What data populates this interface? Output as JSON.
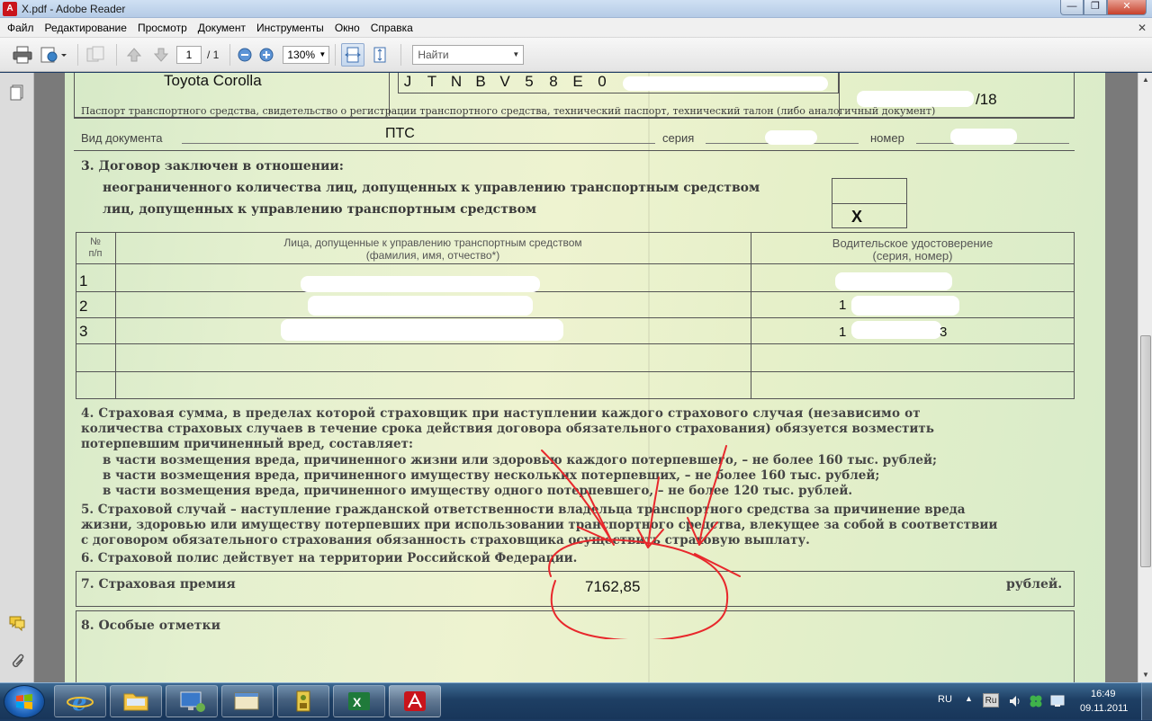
{
  "window": {
    "title": "X.pdf - Adobe Reader",
    "controls": {
      "minimize": "—",
      "maximize": "❐",
      "close": "✕"
    }
  },
  "menu": {
    "items": [
      "Файл",
      "Редактирование",
      "Просмотр",
      "Документ",
      "Инструменты",
      "Окно",
      "Справка"
    ],
    "close_doc": "✕"
  },
  "toolbar": {
    "page_current": "1",
    "page_total": "/ 1",
    "zoom": "130%",
    "search_placeholder": "Найти"
  },
  "document": {
    "car_model": "Toyota Corolla",
    "vin_visible": [
      "J",
      "T",
      "N",
      "B",
      "V",
      "5",
      "8",
      "E",
      "0"
    ],
    "number_suffix": "/18",
    "doc_types_line": "Паспорт транспортного средства, свидетельство о регистрации транспортного средства, технический паспорт, технический талон (либо аналогичный документ)",
    "doc_type_label": "Вид документа",
    "doc_type_value": "ПТС",
    "series_label": "серия",
    "number_label": "номер",
    "section3_title": "3. Договор заключен в отношении:",
    "section3_opt1": "неограниченного количества лиц, допущенных к управлению транспортным средством",
    "section3_opt2": "лиц, допущенных к управлению транспортным средством",
    "section3_mark": "X",
    "table_col_num": "№\nп/п",
    "table_col_persons": "Лица, допущенные к управлению транспортным средством",
    "table_col_persons_sub": "(фамилия, имя, отчество*)",
    "table_col_license": "Водительское удостоверение",
    "table_col_license_sub": "(серия, номер)",
    "table_rows": [
      "1",
      "2",
      "3",
      "",
      ""
    ],
    "license_fragments": [
      "1",
      "1",
      "3"
    ],
    "section4_l1": "4. Страховая сумма, в пределах которой страховщик при наступлении каждого страхового случая (независимо от",
    "section4_l2": "количества страховых случаев в течение срока действия договора обязательного страхования) обязуется возместить",
    "section4_l3": "потерпевшим причиненный вред, составляет:",
    "section4_b1": "в части возмещения вреда, причиненного жизни или здоровью каждого потерпевшего, – не более 160 тыс. рублей;",
    "section4_b2": "в части возмещения вреда, причиненного имуществу нескольких потерпевших, – не более 160 тыс. рублей;",
    "section4_b3": "в части возмещения вреда, причиненного имуществу одного потерпевшего, – не более 120 тыс. рублей.",
    "section5_l1": "5. Страховой случай – наступление гражданской ответственности владельца транспортного средства за причинение вреда",
    "section5_l2": "жизни, здоровью или имуществу потерпевших при использовании транспортного средства, влекущее за собой в соответствии",
    "section5_l3": "с договором обязательного страхования обязанность страховщика осуществить страховую выплату.",
    "section6": "6. Страховой полис действует на территории Российской Федерации.",
    "section7_label": "7. Страховая премия",
    "premium_value": "7162,85",
    "premium_unit": "рублей.",
    "section8_label": "8. Особые отметки",
    "annotation_color": "#e8282c"
  },
  "taskbar": {
    "lang": "RU",
    "lang_badge": "Ru",
    "time": "16:49",
    "date": "09.11.2011"
  }
}
